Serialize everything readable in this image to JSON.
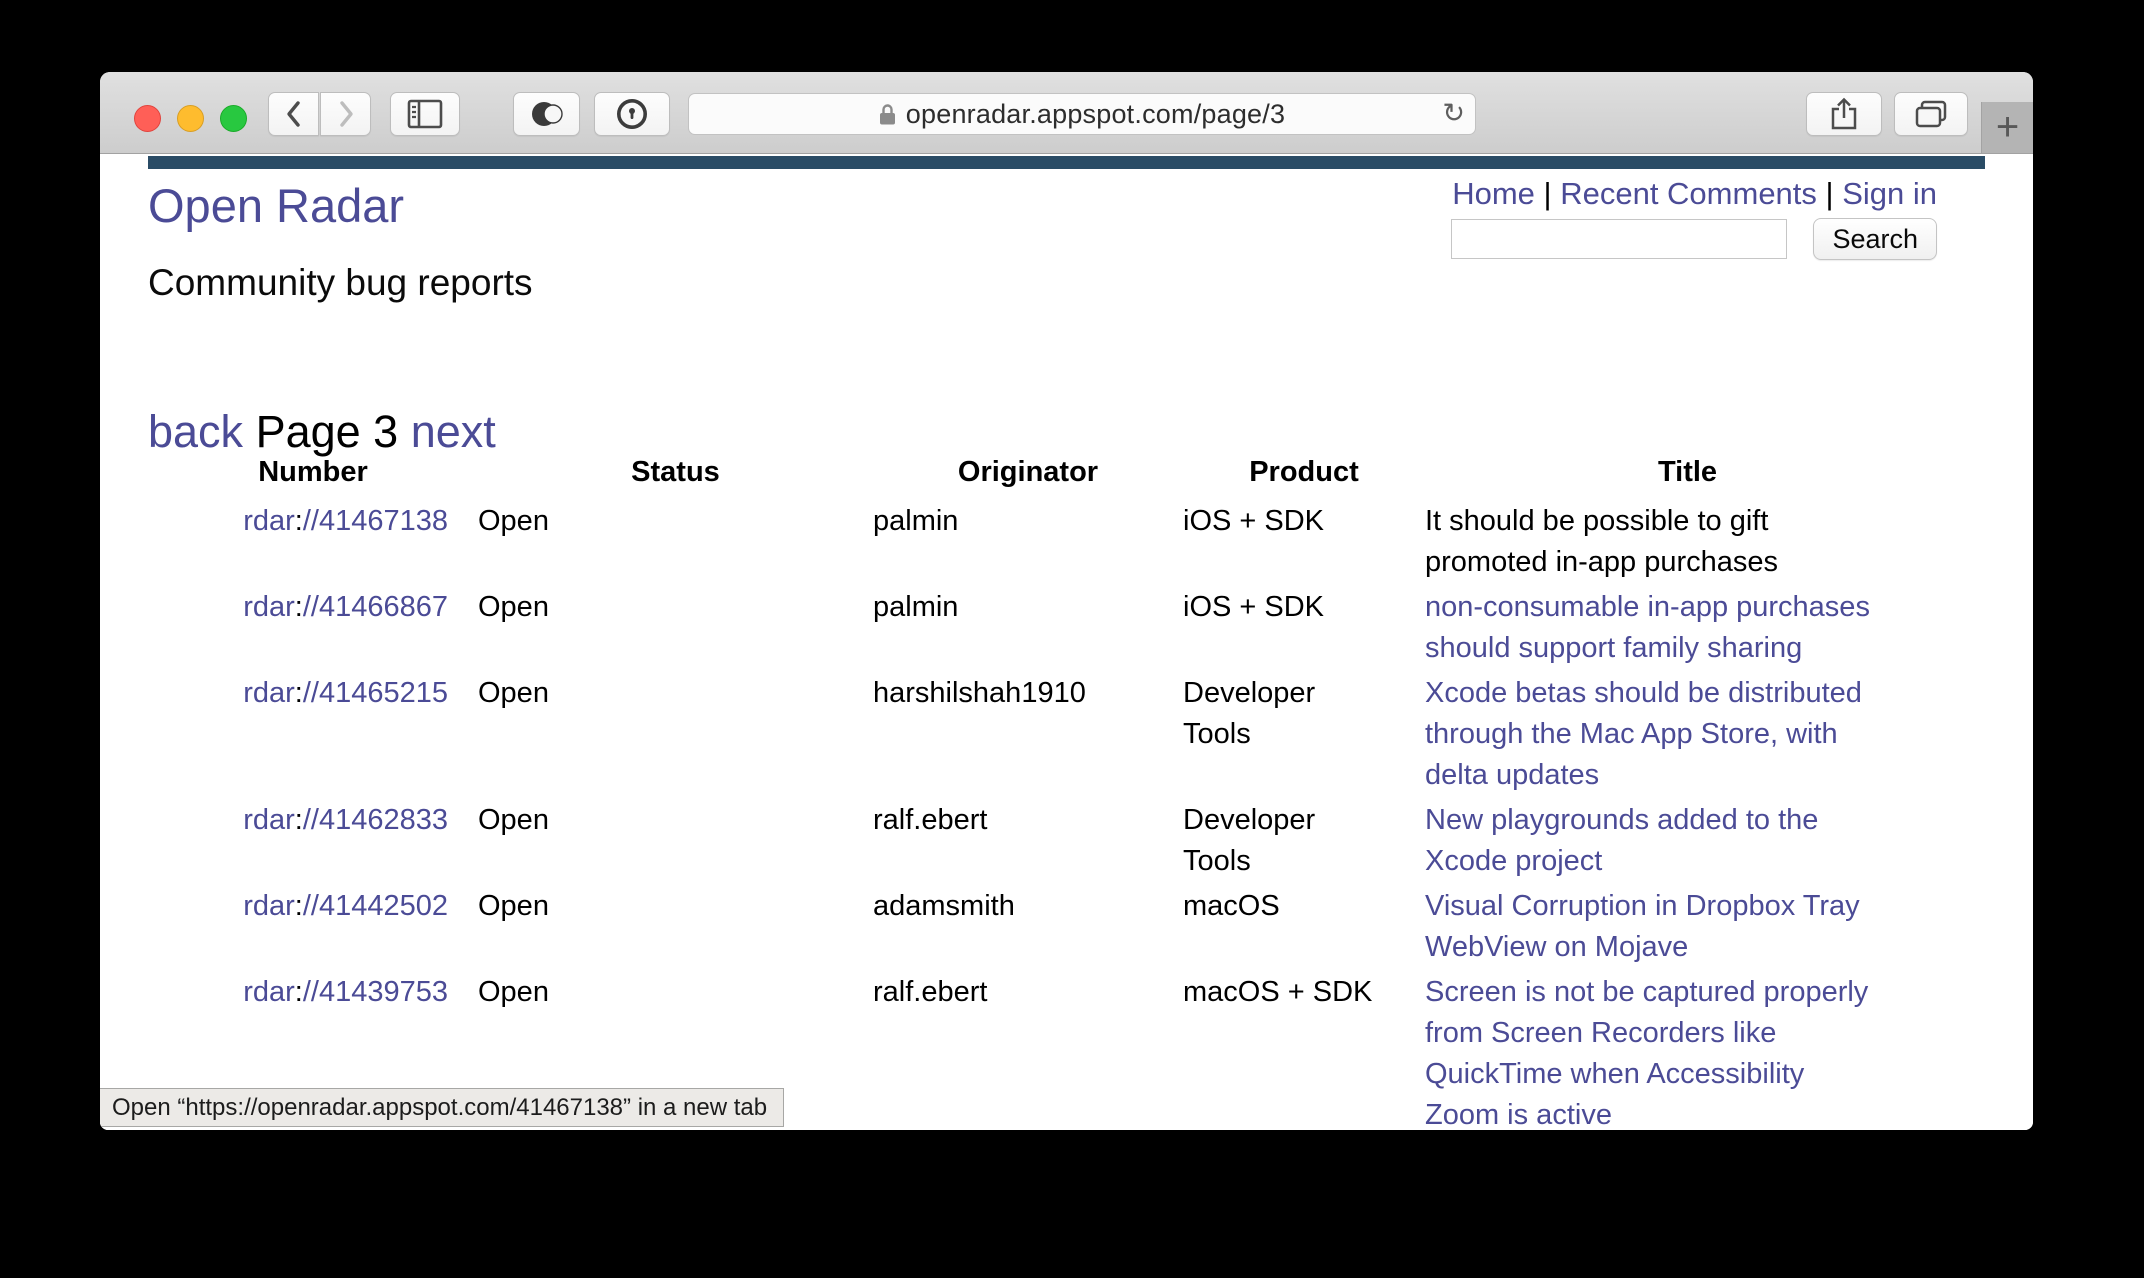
{
  "colors": {
    "link_purple": "#4b4b96",
    "header_bar_navy": "#2a4c66",
    "toolbar_gray": "#d6d6d6",
    "visited_title_black": "#000000"
  },
  "browser_chrome": {
    "url": "openradar.appspot.com/page/3",
    "reload_icon": "↻",
    "new_tab_label": "+",
    "status_bar_text": "Open “https://openradar.appspot.com/41467138” in a new tab"
  },
  "page": {
    "site_title": "Open Radar",
    "tagline": "Community bug reports",
    "nav_links": [
      "Home",
      "Recent Comments",
      "Sign in"
    ],
    "nav_separator": " | ",
    "search": {
      "value": "",
      "button_label": "Search"
    },
    "pagination": {
      "back_label": "back",
      "current_label": "Page 3",
      "next_label": "next"
    },
    "table": {
      "headers": [
        "Number",
        "Status",
        "Originator",
        "Product",
        "Title"
      ],
      "rows": [
        {
          "number": {
            "scheme": "rdar",
            "separator": ":",
            "path": "//41467138"
          },
          "status": "Open",
          "originator": "palmin",
          "product": "iOS + SDK",
          "title_lines": [
            "It should be possible to gift",
            "promoted in-app purchases"
          ],
          "title_color": "black"
        },
        {
          "number": {
            "scheme": "rdar",
            "separator": ":",
            "path": "//41466867"
          },
          "status": "Open",
          "originator": "palmin",
          "product": "iOS + SDK",
          "title_lines": [
            "non-consumable in-app purchases",
            "should support family sharing"
          ],
          "title_color": "link"
        },
        {
          "number": {
            "scheme": "rdar",
            "separator": ":",
            "path": "//41465215"
          },
          "status": "Open",
          "originator": "harshilshah1910",
          "product": "Developer Tools",
          "title_lines": [
            "Xcode betas should be distributed",
            "through the Mac App Store, with",
            "delta updates"
          ],
          "title_color": "link"
        },
        {
          "number": {
            "scheme": "rdar",
            "separator": ":",
            "path": "//41462833"
          },
          "status": "Open",
          "originator": "ralf.ebert",
          "product": "Developer Tools",
          "title_lines": [
            "New playgrounds added to the",
            "Xcode project"
          ],
          "title_color": "link"
        },
        {
          "number": {
            "scheme": "rdar",
            "separator": ":",
            "path": "//41442502"
          },
          "status": "Open",
          "originator": "adamsmith",
          "product": "macOS",
          "title_lines": [
            "Visual Corruption in Dropbox Tray",
            "WebView on Mojave"
          ],
          "title_color": "link"
        },
        {
          "number": {
            "scheme": "rdar",
            "separator": ":",
            "path": "//41439753"
          },
          "status": "Open",
          "originator": "ralf.ebert",
          "product": "macOS + SDK",
          "title_lines": [
            "Screen is not be captured properly",
            "from Screen Recorders like",
            "QuickTime when Accessibility",
            "Zoom is active"
          ],
          "title_color": "link"
        }
      ]
    }
  }
}
